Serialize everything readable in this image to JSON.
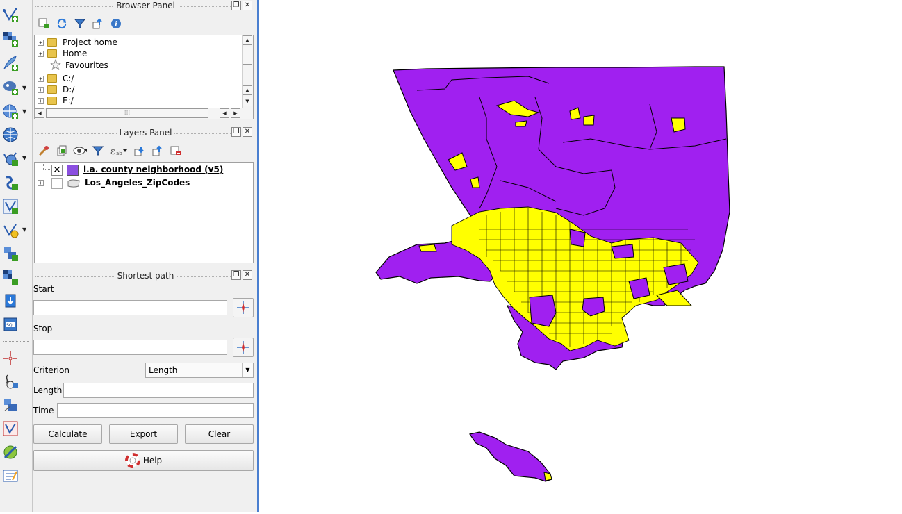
{
  "browser_panel": {
    "title": "Browser Panel",
    "items": [
      {
        "label": "Project home",
        "icon": "folder-icon"
      },
      {
        "label": "Home",
        "icon": "folder-icon"
      },
      {
        "label": "Favourites",
        "icon": "star-icon"
      },
      {
        "label": "C:/",
        "icon": "folder-icon"
      },
      {
        "label": "D:/",
        "icon": "folder-icon"
      },
      {
        "label": "E:/",
        "icon": "folder-icon"
      }
    ]
  },
  "layers_panel": {
    "title": "Layers Panel",
    "layers": [
      {
        "name": "l.a. county neighborhood (v5)",
        "checked": true,
        "swatch": "#8b4fe0"
      },
      {
        "name": "Los_Angeles_ZipCodes",
        "checked": false,
        "swatch": "#d8d8d8"
      }
    ]
  },
  "shortest_path": {
    "title": "Shortest path",
    "start_label": "Start",
    "start_value": "",
    "stop_label": "Stop",
    "stop_value": "",
    "criterion_label": "Criterion",
    "criterion_value": "Length",
    "length_label": "Length",
    "length_value": "",
    "time_label": "Time",
    "time_value": "",
    "calculate_label": "Calculate",
    "export_label": "Export",
    "clear_label": "Clear",
    "help_label": "Help"
  },
  "map": {
    "neighborhood_fill": "#a020f0",
    "zipcode_fill": "#ffff00",
    "outline": "#000000"
  },
  "colors": {
    "dock_accent": "#4a7fd0"
  }
}
